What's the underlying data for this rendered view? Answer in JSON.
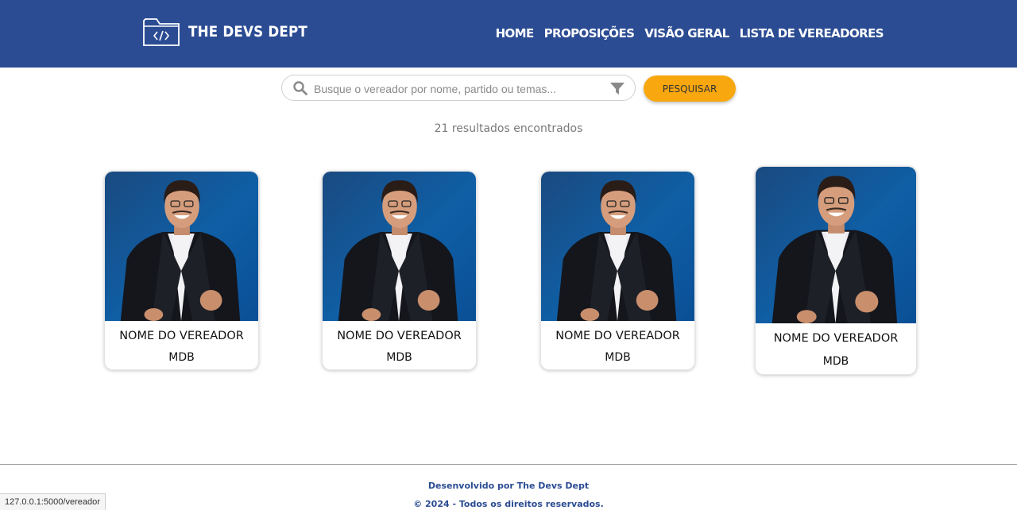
{
  "header": {
    "logo_text": "THE DEVS DEPT",
    "nav": [
      "HOME",
      "PROPOSIÇÕES",
      "VISÃO GERAL",
      "LISTA DE VEREADORES"
    ]
  },
  "search": {
    "placeholder": "Busque o vereador por nome, partido ou temas...",
    "value": "",
    "button_label": "PESQUISAR"
  },
  "results_text": "21 resultados encontrados",
  "cards": [
    {
      "name": "NOME DO VEREADOR",
      "party": "MDB"
    },
    {
      "name": "NOME DO VEREADOR",
      "party": "MDB"
    },
    {
      "name": "NOME DO VEREADOR",
      "party": "MDB"
    },
    {
      "name": "NOME DO VEREADOR",
      "party": "MDB"
    }
  ],
  "footer": {
    "developed_by": "Desenvolvido por The Devs Dept",
    "copyright": "© 2024 - Todos os direitos reservados."
  },
  "status_bar_url": "127.0.0.1:5000/vereador",
  "colors": {
    "header": "#2b4c93",
    "accent": "#f8a70f",
    "photo_background": "#0f5fa6"
  },
  "icons": [
    "code-folder-icon",
    "search-icon",
    "filter-icon"
  ]
}
